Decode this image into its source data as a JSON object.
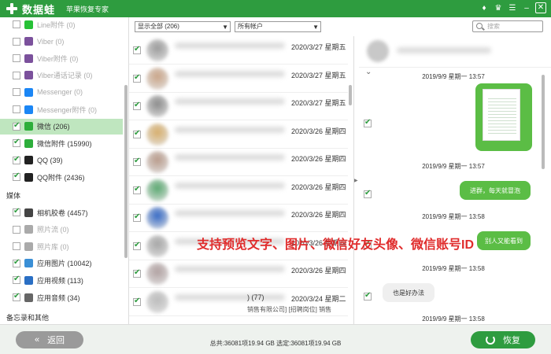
{
  "app": {
    "brand": "数据蛙",
    "subtitle": "苹果恢复专家",
    "controls": [
      "♦",
      "♛",
      "☰",
      "–",
      "✕"
    ]
  },
  "sidebar": {
    "items": [
      {
        "label": "Line附件 (0)",
        "checked": false,
        "disabled": true,
        "icon": "line-icon",
        "color": "#27c137"
      },
      {
        "label": "Viber (0)",
        "checked": false,
        "disabled": true,
        "icon": "viber-icon",
        "color": "#7b519c"
      },
      {
        "label": "Viber附件 (0)",
        "checked": false,
        "disabled": true,
        "icon": "viber-icon",
        "color": "#7b519c"
      },
      {
        "label": "Viber通话记录 (0)",
        "checked": false,
        "disabled": true,
        "icon": "viber-icon",
        "color": "#7b519c"
      },
      {
        "label": "Messenger (0)",
        "checked": false,
        "disabled": true,
        "icon": "messenger-icon",
        "color": "#1b86f5"
      },
      {
        "label": "Messenger附件 (0)",
        "checked": false,
        "disabled": true,
        "icon": "messenger-icon",
        "color": "#1b86f5"
      },
      {
        "label": "微信 (206)",
        "checked": true,
        "disabled": false,
        "icon": "wechat-icon",
        "color": "#2dae3b",
        "selected": true
      },
      {
        "label": "微信附件 (15990)",
        "checked": true,
        "disabled": false,
        "icon": "wechat-icon",
        "color": "#2dae3b"
      },
      {
        "label": "QQ (39)",
        "checked": true,
        "disabled": false,
        "icon": "qq-icon",
        "color": "#222222"
      },
      {
        "label": "QQ附件 (2436)",
        "checked": true,
        "disabled": false,
        "icon": "qq-icon",
        "color": "#222222"
      }
    ],
    "group_media": "媒体",
    "media_items": [
      {
        "label": "相机胶卷 (4457)",
        "checked": true,
        "disabled": false,
        "icon": "camera-icon",
        "color": "#444444"
      },
      {
        "label": "照片流 (0)",
        "checked": false,
        "disabled": true,
        "icon": "photostream-icon",
        "color": "#aaaaaa"
      },
      {
        "label": "照片库 (0)",
        "checked": false,
        "disabled": true,
        "icon": "photolib-icon",
        "color": "#aaaaaa"
      },
      {
        "label": "应用图片 (10042)",
        "checked": true,
        "disabled": false,
        "icon": "app-photo-icon",
        "color": "#3a8fd6"
      },
      {
        "label": "应用视频 (113)",
        "checked": true,
        "disabled": false,
        "icon": "app-video-icon",
        "color": "#2a6fc4"
      },
      {
        "label": "应用音频 (34)",
        "checked": true,
        "disabled": false,
        "icon": "app-audio-icon",
        "color": "#666666"
      }
    ],
    "group_memo": "备忘录和其他"
  },
  "toolbar": {
    "filter_value": "显示全部 (206)",
    "account_value": "所有帐户",
    "search_placeholder": "搜索"
  },
  "list": {
    "rows": [
      {
        "date": "2020/3/27  星期五",
        "sub": "",
        "color": "#9a9a9a"
      },
      {
        "date": "2020/3/27  星期五",
        "sub": "",
        "color": "#c9a487"
      },
      {
        "date": "2020/3/27  星期五",
        "sub": "",
        "color": "#8a8a8a"
      },
      {
        "date": "2020/3/26  星期四",
        "sub": "",
        "color": "#d6ad6a"
      },
      {
        "date": "2020/3/26  星期四",
        "sub": "",
        "color": "#b89a8a"
      },
      {
        "date": "2020/3/26  星期四",
        "sub": "",
        "color": "#5aa870"
      },
      {
        "date": "2020/3/26  星期四",
        "sub": "",
        "color": "#3468c4"
      },
      {
        "date": "2020/3/26  星期四",
        "sub": "",
        "color": "#a5a5a5"
      },
      {
        "date": "2020/3/26  星期四",
        "sub": "",
        "color": "#b0a0a0"
      },
      {
        "date": "2020/3/24  星期二",
        "sub": "销售有限公司] [招聘岗位] 销售",
        "color": "#bbbbbb",
        "prefix": ") (77)"
      }
    ]
  },
  "chat": {
    "messages": [
      {
        "time": "2019/9/9  星期一 13:57",
        "type": "image"
      },
      {
        "time": "2019/9/9  星期一 13:57",
        "type": "text",
        "text": "进群，每天就冒泡",
        "side": "right"
      },
      {
        "time": "2019/9/9  星期一 13:58",
        "type": "text",
        "text": "别人又能看到",
        "side": "right"
      },
      {
        "time": "2019/9/9  星期一 13:58",
        "type": "text",
        "text": "也是好办法",
        "side": "left"
      },
      {
        "time": "2019/9/9  星期一 13:58",
        "type": "none"
      }
    ]
  },
  "overlay": {
    "caption": "支持预览文字、图片、微信好友头像、微信账号ID"
  },
  "footer": {
    "back_label": "返回",
    "total_text": "总共:36081项19.94 GB 选定:36081项19.94 GB",
    "recover_label": "恢复"
  }
}
